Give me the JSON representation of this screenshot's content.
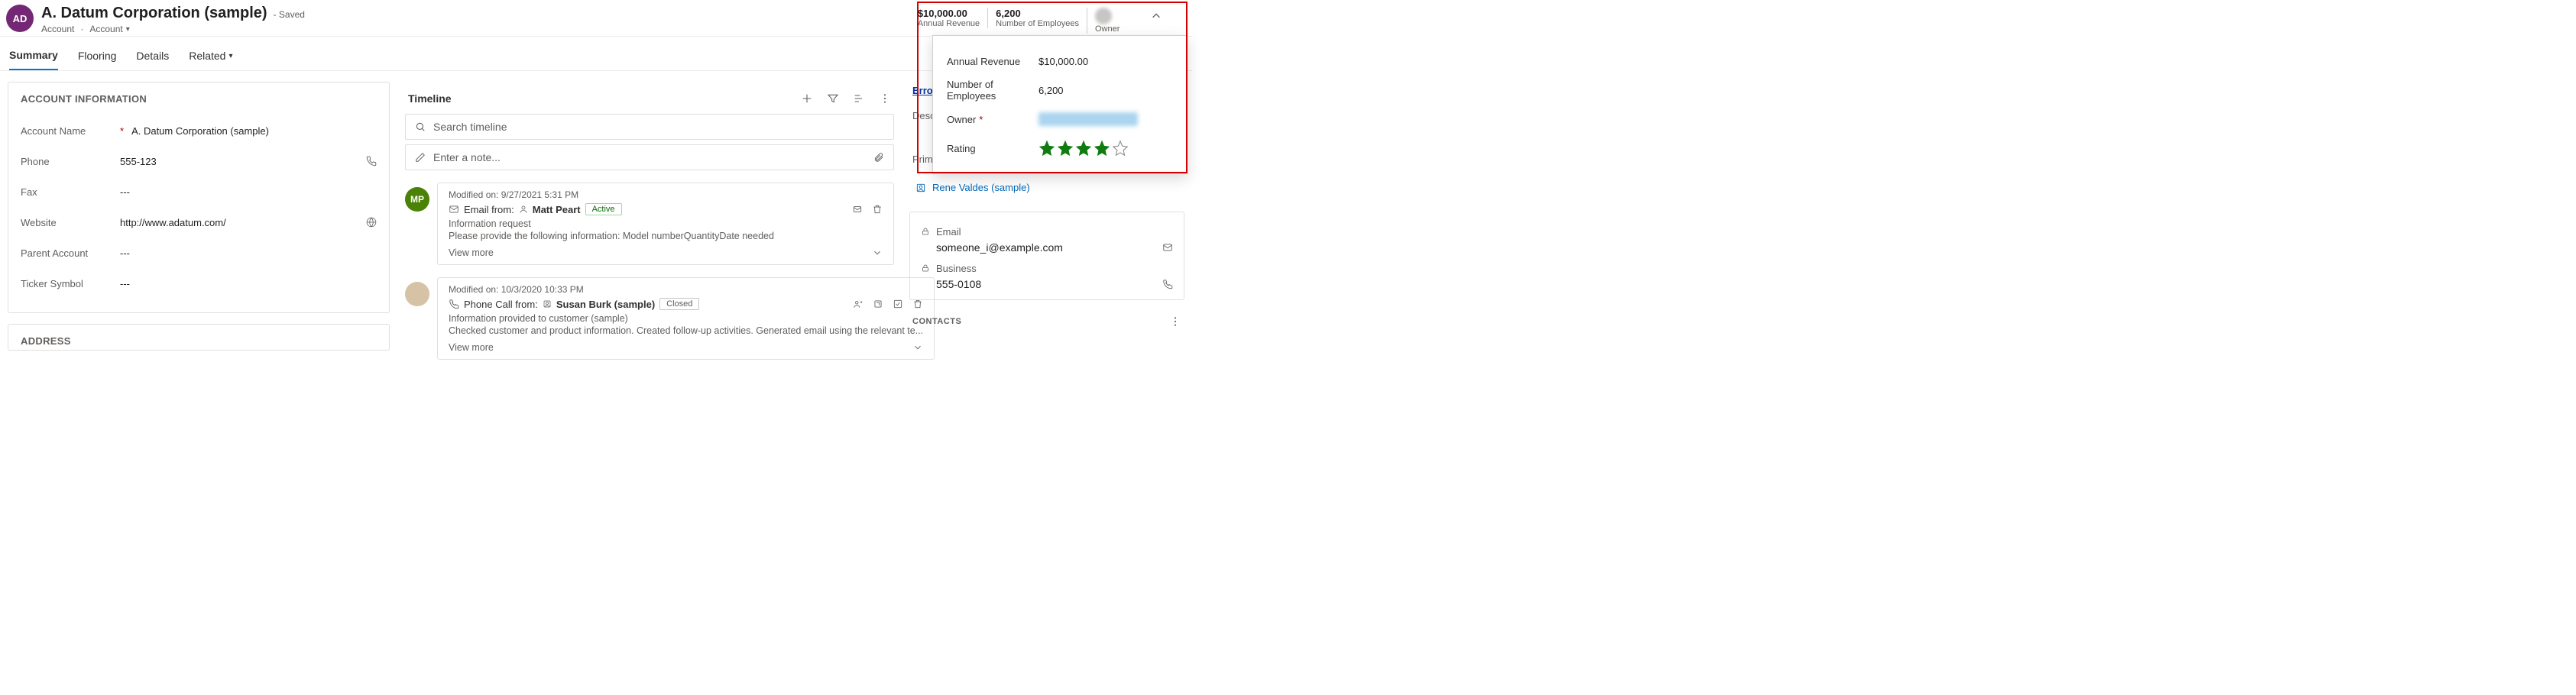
{
  "header": {
    "badge": "AD",
    "title": "A. Datum Corporation (sample)",
    "save_state": "- Saved",
    "crumb_entity": "Account",
    "crumb_form": "Account",
    "metrics": {
      "revenue_value": "$10,000.00",
      "revenue_label": "Annual Revenue",
      "employees_value": "6,200",
      "employees_label": "Number of Employees",
      "owner_label": "Owner"
    }
  },
  "flyout": {
    "revenue_label": "Annual Revenue",
    "revenue_value": "$10,000.00",
    "employees_label": "Number of Employees",
    "employees_value": "6,200",
    "owner_label": "Owner",
    "rating_label": "Rating",
    "rating_value": 4
  },
  "tabs": {
    "summary": "Summary",
    "flooring": "Flooring",
    "details": "Details",
    "related": "Related"
  },
  "account_info": {
    "section": "ACCOUNT INFORMATION",
    "name_label": "Account Name",
    "name_value": "A. Datum Corporation (sample)",
    "phone_label": "Phone",
    "phone_value": "555-123",
    "fax_label": "Fax",
    "fax_value": "---",
    "website_label": "Website",
    "website_value": "http://www.adatum.com/",
    "parent_label": "Parent Account",
    "parent_value": "---",
    "ticker_label": "Ticker Symbol",
    "ticker_value": "---"
  },
  "address": {
    "section": "ADDRESS"
  },
  "timeline": {
    "title": "Timeline",
    "search_placeholder": "Search timeline",
    "note_placeholder": "Enter a note...",
    "items": [
      {
        "avatar_text": "MP",
        "modified": "Modified on: 9/27/2021 5:31 PM",
        "kind_prefix": "Email from:",
        "person": "Matt Peart",
        "status": "Active",
        "subject": "Information request",
        "body": "Please provide the following information:  Model numberQuantityDate needed",
        "more": "View more"
      },
      {
        "avatar_text": "",
        "modified": "Modified on: 10/3/2020 10:33 PM",
        "kind_prefix": "Phone Call from:",
        "person": "Susan Burk (sample)",
        "status": "Closed",
        "subject": "Information provided to customer (sample)",
        "body": "Checked customer and product information. Created follow-up activities. Generated email using the relevant te...",
        "more": "View more"
      }
    ]
  },
  "right": {
    "error": "Error loadi",
    "description_label": "Descrip",
    "primary_contact_label": "Primary Contact",
    "primary_contact_value": "Rene Valdes (sample)",
    "email_label": "Email",
    "email_value": "someone_i@example.com",
    "business_label": "Business",
    "business_value": "555-0108",
    "contacts_label": "CONTACTS"
  }
}
